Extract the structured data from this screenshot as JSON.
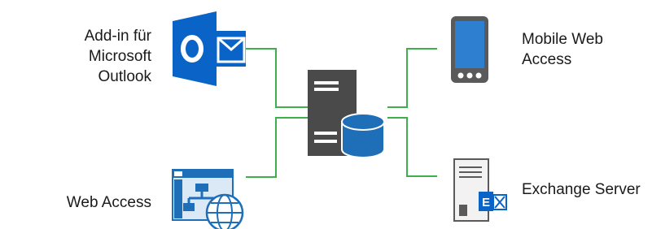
{
  "nodes": {
    "outlook": {
      "line1": "Add-in für",
      "line2": "Microsoft Outlook",
      "icon": "outlook-icon"
    },
    "web_access": {
      "label": "Web Access",
      "icon": "web-access-icon"
    },
    "mobile": {
      "line1": "Mobile Web",
      "line2": "Access",
      "icon": "mobile-phone-icon"
    },
    "exchange": {
      "label": "Exchange Server",
      "icon": "exchange-server-icon"
    },
    "center": {
      "icon": "server-database-icon"
    },
    "exchange_badge": "E"
  },
  "colors": {
    "outlook_blue": "#0a64c8",
    "connector_green": "#3cb04a",
    "server_gray": "#4a4a4a",
    "database_blue": "#1e6eb8",
    "label_text": "#1a1a1a"
  }
}
